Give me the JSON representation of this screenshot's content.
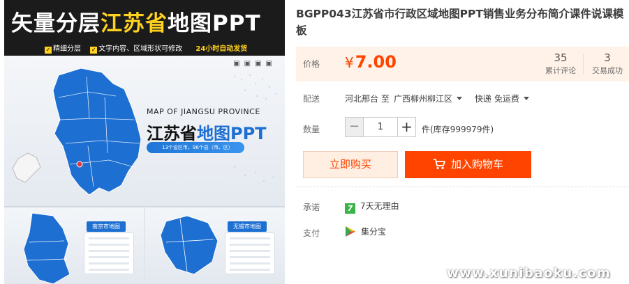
{
  "hero": {
    "title_a": "矢量分层",
    "title_b": "江苏省",
    "title_c": "地图PPT",
    "features": [
      "精细分层",
      "文字内容、区域形状可修改"
    ],
    "badge": "24小时自动发货",
    "slide_sub": "MAP OF JIANGSU PROVINCE",
    "slide_title_a": "江苏省",
    "slide_title_b": "地图PPT",
    "slide_pill": "13个设区市，96个县（市、区）",
    "thumb1_label": "南京市地图",
    "thumb2_label": "无锡市地图"
  },
  "product": {
    "title": "BGPP043江苏省市行政区域地图PPT销售业务分布简介课件说课模板",
    "price_label": "价格",
    "currency": "¥",
    "price": "7.00",
    "reviews_count": "35",
    "reviews_label": "累计评论",
    "deals_count": "3",
    "deals_label": "交易成功"
  },
  "delivery": {
    "label": "配送",
    "from": "河北邢台 至",
    "to": "广西柳州柳江区",
    "method": "快递 免运费"
  },
  "quantity": {
    "label": "数量",
    "value": "1",
    "minus": "−",
    "plus": "+",
    "stock": "件(库存999979件)"
  },
  "actions": {
    "buy_now": "立即购买",
    "add_cart": "加入购物车"
  },
  "promise": {
    "label": "承诺",
    "badge": "7",
    "text": "7天无理由"
  },
  "payment": {
    "label": "支付",
    "text": "集分宝"
  },
  "watermark": "www.xunibaoku.com",
  "colors": {
    "accent": "#ff4400",
    "price_bg": "#fff2e8",
    "map_blue": "#1d6fd1",
    "banner_yellow": "#ffd21f"
  }
}
